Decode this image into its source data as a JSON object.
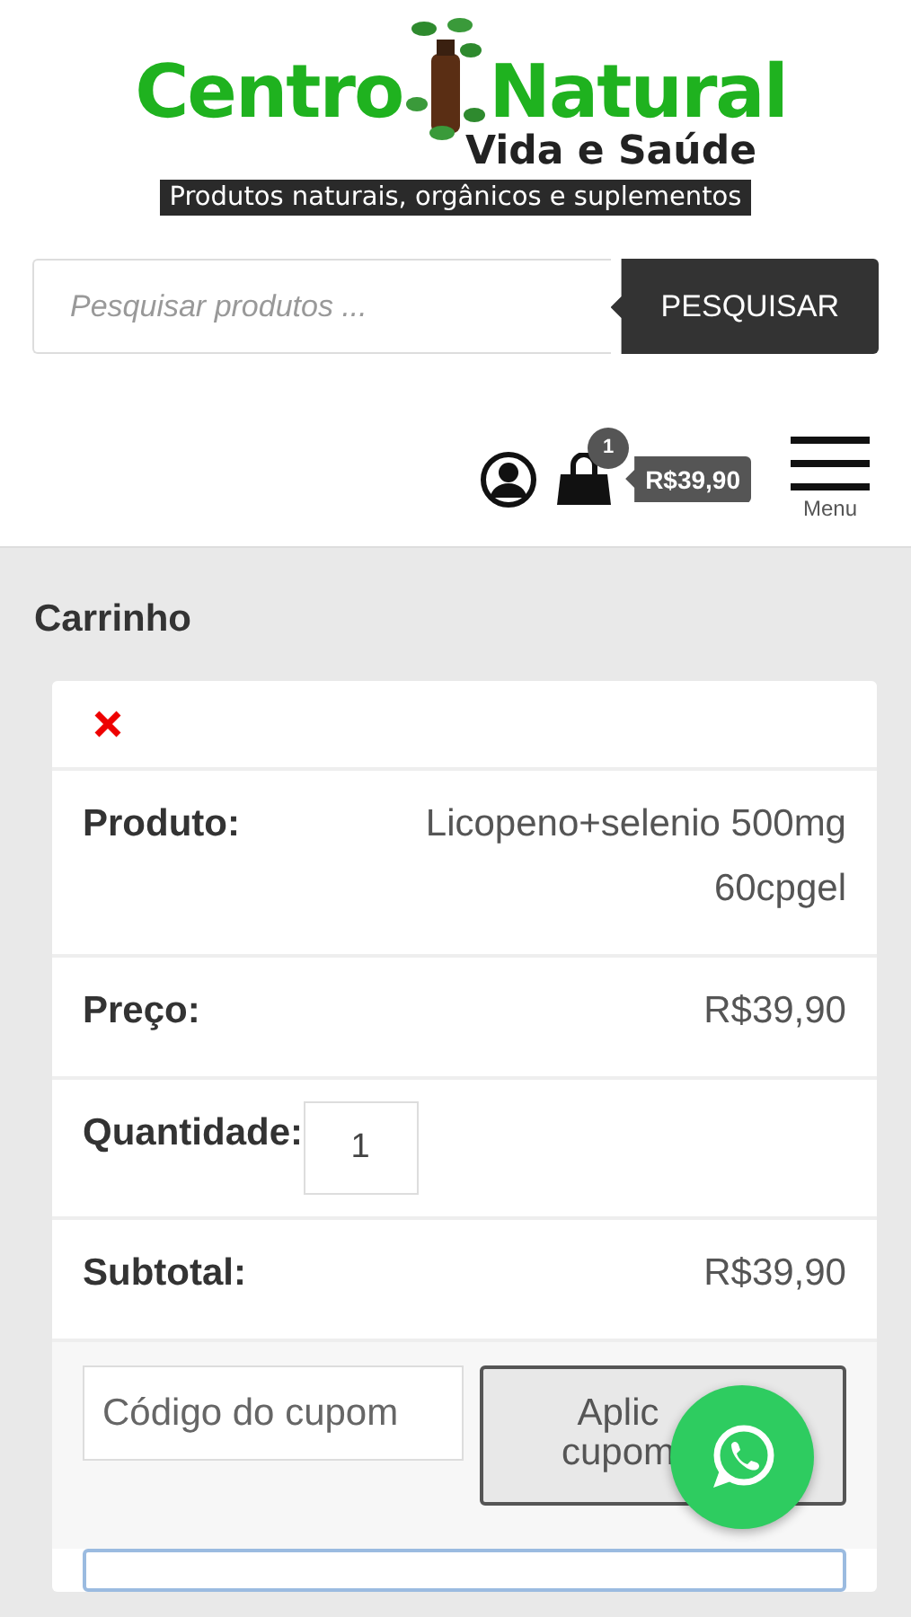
{
  "logo": {
    "word_1": "Centro",
    "word_2": "Natural",
    "subtitle": "Vida e Saúde",
    "tagline": "Produtos naturais, orgânicos e suplementos"
  },
  "search": {
    "placeholder": "Pesquisar produtos ...",
    "button": "PESQUISAR"
  },
  "header": {
    "cart_count": "1",
    "cart_total": "R$39,90",
    "menu_label": "Menu"
  },
  "page_title": "Carrinho",
  "cart_rows": [
    {
      "kind": "remove"
    },
    {
      "kind": "text",
      "label": "Produto:",
      "value": "Licopeno+selenio 500mg 60cpgel"
    },
    {
      "kind": "text",
      "label": "Preço:",
      "value": "R$39,90"
    },
    {
      "kind": "quantity",
      "label": "Quantidade:",
      "value": "1"
    },
    {
      "kind": "text",
      "label": "Subtotal:",
      "value": "R$39,90"
    }
  ],
  "coupon": {
    "placeholder": "Código do cupom",
    "button_lines": [
      "Aplic",
      "cupom"
    ]
  }
}
